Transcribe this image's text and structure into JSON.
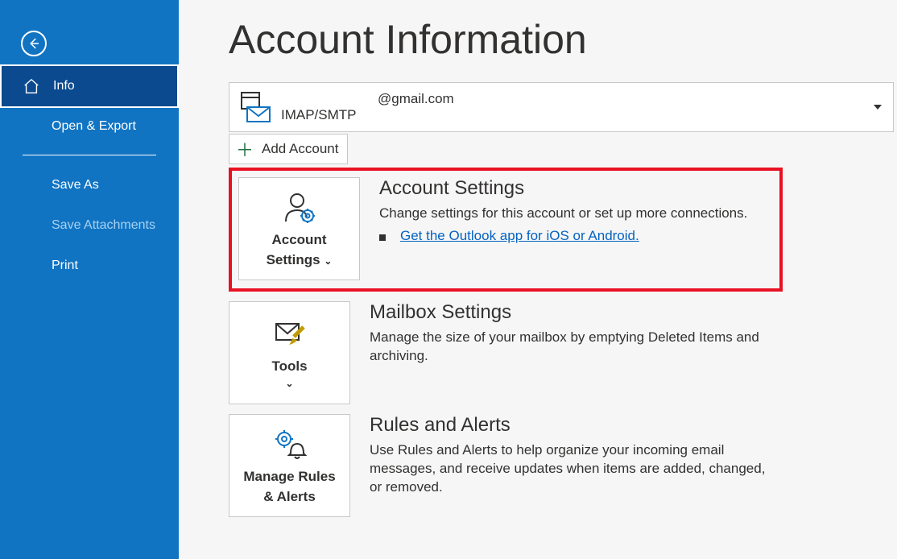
{
  "sidebar": {
    "items": [
      {
        "label": "Info"
      },
      {
        "label": "Open & Export"
      },
      {
        "label": "Save As"
      },
      {
        "label": "Save Attachments"
      },
      {
        "label": "Print"
      }
    ]
  },
  "page_title": "Account Information",
  "account": {
    "email_suffix": "@gmail.com",
    "protocol": "IMAP/SMTP"
  },
  "add_account_label": "Add Account",
  "sections": {
    "account_settings": {
      "tile_label1": "Account",
      "tile_label2": "Settings",
      "title": "Account Settings",
      "desc": "Change settings for this account or set up more connections.",
      "link": "Get the Outlook app for iOS or Android."
    },
    "mailbox": {
      "tile_label": "Tools",
      "title": "Mailbox Settings",
      "desc": "Manage the size of your mailbox by emptying Deleted Items and archiving."
    },
    "rules": {
      "tile_label1": "Manage Rules",
      "tile_label2": "& Alerts",
      "title": "Rules and Alerts",
      "desc": "Use Rules and Alerts to help organize your incoming email messages, and receive updates when items are added, changed, or removed."
    }
  }
}
